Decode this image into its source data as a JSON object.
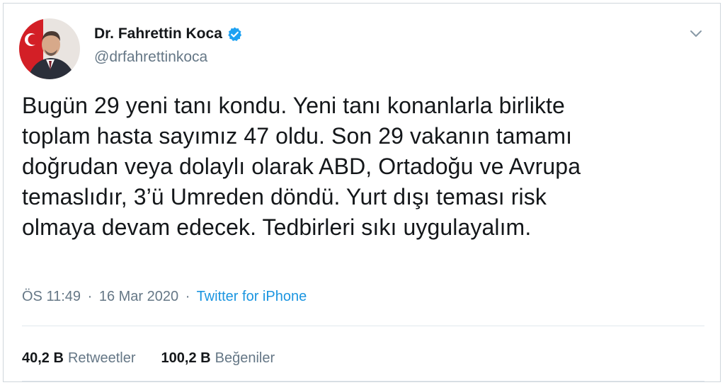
{
  "colors": {
    "text": "#14171a",
    "secondary": "#657786",
    "link": "#1b95e0",
    "verified": "#1da1f2"
  },
  "author": {
    "display_name": "Dr. Fahrettin Koca",
    "handle": "@drfahrettinkoca",
    "verified": true
  },
  "tweet": {
    "lines": [
      "Bugün 29 yeni tanı kondu. Yeni tanı konanlarla birlikte",
      "toplam hasta sayımız 47 oldu. Son 29 vakanın tamamı",
      "doğrudan veya dolaylı olarak ABD, Ortadoğu ve Avrupa",
      "temaslıdır, 3’ü Umreden döndü. Yurt dışı teması risk",
      "olmaya devam edecek. Tedbirleri sıkı uygulayalım."
    ]
  },
  "meta": {
    "time": "ÖS 11:49",
    "separator": "·",
    "date": "16 Mar 2020",
    "source": "Twitter for iPhone"
  },
  "stats": {
    "retweets_count": "40,2 B",
    "retweets_label": "Retweetler",
    "likes_count": "100,2 B",
    "likes_label": "Beğeniler"
  },
  "icons": {
    "verified": "verified-badge-icon",
    "caret": "chevron-down-icon"
  }
}
